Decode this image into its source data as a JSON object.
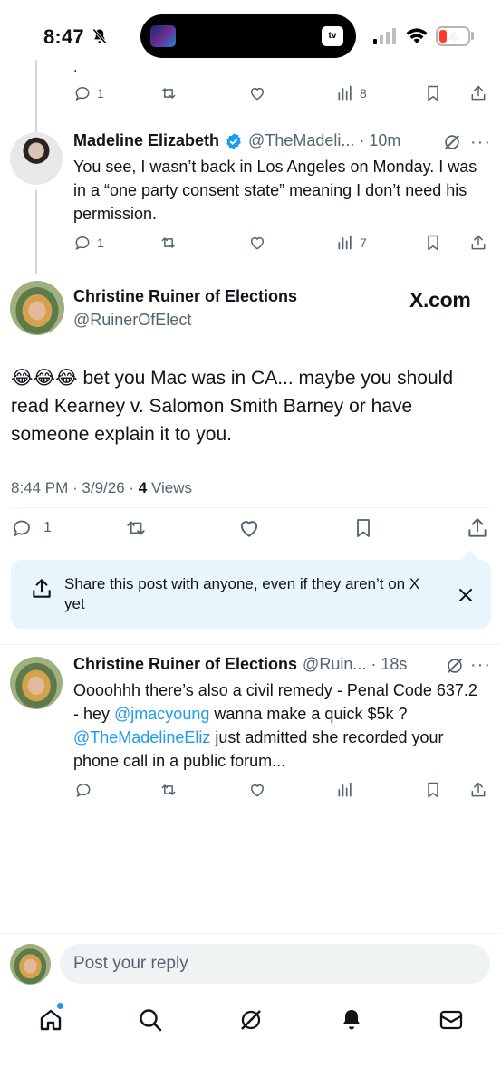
{
  "status_bar": {
    "time": "8:47",
    "battery": "4",
    "tv_badge": "tv"
  },
  "prev_reply": {
    "dot": ".",
    "replies": "1",
    "views": "8"
  },
  "madeline": {
    "name": "Madeline Elizabeth",
    "handle_time": "@TheMadeli... · 10m",
    "text": "You see, I wasn’t back in Los Angeles on Monday. I was in a “one party consent state”  meaning I don’t need his permission.",
    "replies": "1",
    "views": "7"
  },
  "main_post": {
    "name": "Christine Ruiner of Elections",
    "handle": "@RuinerOfElect",
    "watermark": "X.com",
    "emoji": "😂😂😂",
    "text": " bet you Mac was in CA... maybe you should read Kearney v. Salomon Smith Barney or have someone explain it to you.",
    "meta_time": "8:44 PM · 3/9/26 · ",
    "views_count": "4",
    "views_label": " Views",
    "replies": "1"
  },
  "share_prompt": {
    "text": "Share this post with anyone, even if they aren’t on X yet"
  },
  "christine_reply": {
    "name": "Christine Ruiner of Elections",
    "handle_time": "@Ruin... · 18s",
    "text_1": "Oooohhh there’s also a civil remedy - Penal Code 637.2 - hey ",
    "mention_1": "@jmacyoung",
    "text_2": " wanna make a quick $5k ? ",
    "mention_2": "@TheMadelineEliz",
    "text_3": " just admitted she recorded your phone call in a public forum..."
  },
  "reply_bar": {
    "placeholder": "Post your reply"
  },
  "colors": {
    "accent": "#1d9bf0",
    "muted": "#536471",
    "share_bg": "#e8f5fd",
    "text": "#0f1419"
  },
  "icons": [
    "bell-slash-icon",
    "signal-icon",
    "wifi-icon",
    "reply-icon",
    "repost-icon",
    "like-icon",
    "views-icon",
    "bookmark-icon",
    "share-icon",
    "verified-icon",
    "grok-icon",
    "more-icon",
    "close-icon",
    "home-icon",
    "search-icon",
    "bell-icon",
    "mail-icon"
  ]
}
